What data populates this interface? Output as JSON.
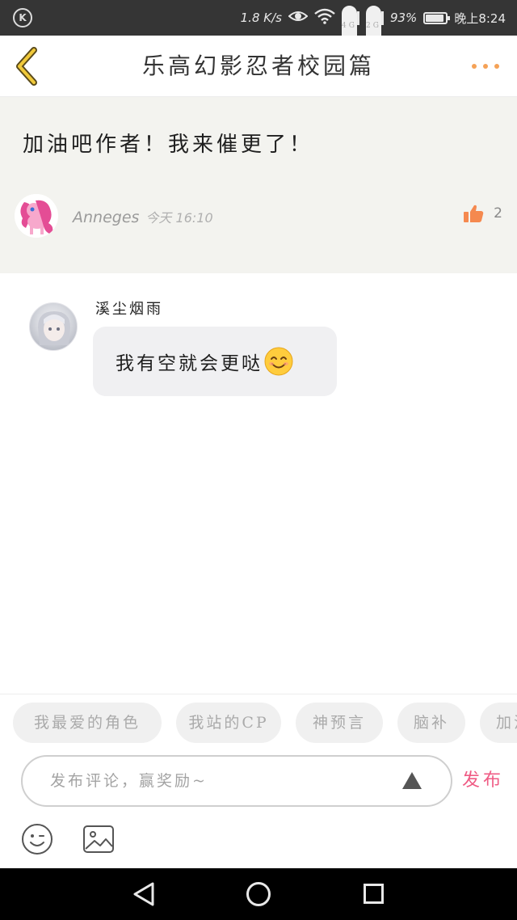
{
  "status_bar": {
    "k_icon": "K",
    "speed": "1.8 K/s",
    "eye_icon": "eye-comfort-icon",
    "wifi_icon": "wifi-icon",
    "net1": "4G",
    "net2": "2G",
    "battery": "93%",
    "battery_level": 0.93,
    "time": "晚上8:24"
  },
  "header": {
    "title": "乐高幻影忍者校园篇",
    "back_icon": "chevron-left-icon",
    "more_icon": "more-dots-icon",
    "accent": "#f5a257"
  },
  "original_comment": {
    "text": "加油吧作者！我来催更了！",
    "author": "Anneges",
    "time": "今天 16:10",
    "likes": "2",
    "like_icon": "thumbs-up-icon",
    "like_color": "#f5894f"
  },
  "reply": {
    "author": "溪尘烟雨",
    "text": "我有空就会更哒"
  },
  "tags": [
    "我最爱的角色",
    "我站的CP",
    "神预言",
    "脑补",
    "加油"
  ],
  "composer": {
    "placeholder": "发布评论，赢奖励~",
    "publish_label": "发布",
    "publish_color": "#ef5b84"
  }
}
